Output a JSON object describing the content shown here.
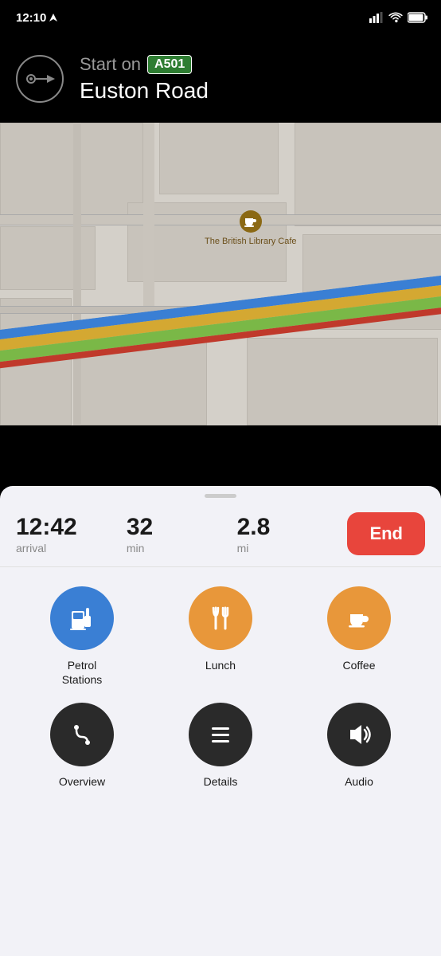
{
  "statusBar": {
    "time": "12:10",
    "signalBars": 3,
    "wifi": true,
    "battery": "full"
  },
  "navHeader": {
    "startOnLabel": "Start on",
    "roadBadge": "A501",
    "roadName": "Euston Road"
  },
  "cafeMarker": {
    "name": "The British Library Cafe"
  },
  "eta": {
    "arrivalTime": "12:42",
    "arrivalLabel": "arrival",
    "minutes": "32",
    "minutesLabel": "min",
    "distance": "2.8",
    "distanceLabel": "mi",
    "endButtonLabel": "End"
  },
  "options": {
    "row1": [
      {
        "id": "petrol",
        "label": "Petrol\nStations",
        "colorClass": "circle-blue"
      },
      {
        "id": "lunch",
        "label": "Lunch",
        "colorClass": "circle-orange"
      },
      {
        "id": "coffee",
        "label": "Coffee",
        "colorClass": "circle-orange"
      }
    ],
    "row2": [
      {
        "id": "overview",
        "label": "Overview",
        "colorClass": "circle-dark"
      },
      {
        "id": "details",
        "label": "Details",
        "colorClass": "circle-dark"
      },
      {
        "id": "audio",
        "label": "Audio",
        "colorClass": "circle-dark"
      }
    ]
  }
}
